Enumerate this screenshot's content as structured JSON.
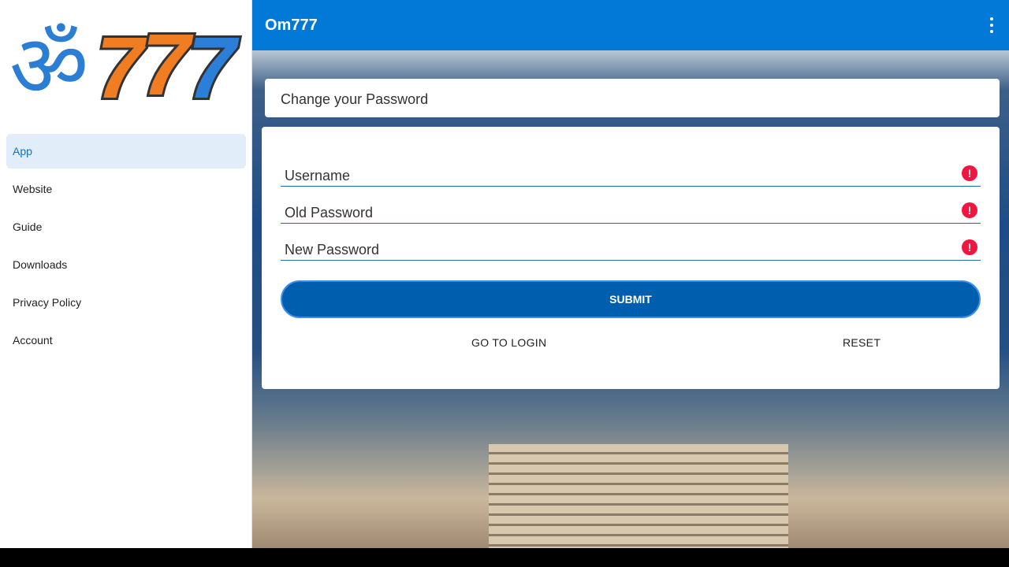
{
  "sidebar": {
    "logo_text": "ॐ777",
    "items": [
      {
        "label": "App",
        "active": true
      },
      {
        "label": "Website"
      },
      {
        "label": "Guide"
      },
      {
        "label": "Downloads"
      },
      {
        "label": "Privacy Policy"
      },
      {
        "label": "Account"
      }
    ]
  },
  "header": {
    "title": "Om777",
    "menu_icon": "more-vert-icon"
  },
  "page": {
    "title": "Change your Password"
  },
  "form": {
    "fields": [
      {
        "placeholder": "Username",
        "value": ""
      },
      {
        "placeholder": "Old Password",
        "value": ""
      },
      {
        "placeholder": "New Password",
        "value": ""
      }
    ],
    "error_icon": "error-icon",
    "submit": "SUBMIT",
    "go_to_login": "GO TO LOGIN",
    "reset": "RESET"
  },
  "colors": {
    "accent": "#0278d7",
    "button": "#005eae",
    "error": "#f0163f"
  }
}
